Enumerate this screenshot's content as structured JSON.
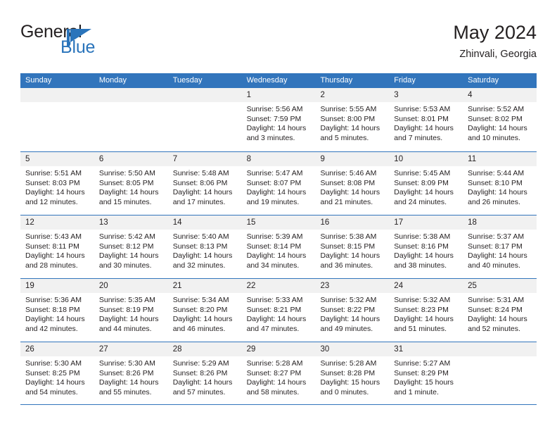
{
  "brand": {
    "name_part1": "General",
    "name_part2": "Blue",
    "logo_icon": "triangle-logo-icon"
  },
  "header": {
    "title": "May 2024",
    "subtitle": "Zhinvali, Georgia"
  },
  "colors": {
    "header_blue": "#3275bc",
    "brand_blue": "#2a74bb",
    "day_band_gray": "#f1f1f1",
    "text": "#231f20"
  },
  "weekdays": [
    "Sunday",
    "Monday",
    "Tuesday",
    "Wednesday",
    "Thursday",
    "Friday",
    "Saturday"
  ],
  "weeks": [
    [
      {
        "day": "",
        "empty": true,
        "sunrise": "",
        "sunset": "",
        "daylight_a": "",
        "daylight_b": ""
      },
      {
        "day": "",
        "empty": true,
        "sunrise": "",
        "sunset": "",
        "daylight_a": "",
        "daylight_b": ""
      },
      {
        "day": "",
        "empty": true,
        "sunrise": "",
        "sunset": "",
        "daylight_a": "",
        "daylight_b": ""
      },
      {
        "day": "1",
        "empty": false,
        "sunrise": "Sunrise: 5:56 AM",
        "sunset": "Sunset: 7:59 PM",
        "daylight_a": "Daylight: 14 hours",
        "daylight_b": "and 3 minutes."
      },
      {
        "day": "2",
        "empty": false,
        "sunrise": "Sunrise: 5:55 AM",
        "sunset": "Sunset: 8:00 PM",
        "daylight_a": "Daylight: 14 hours",
        "daylight_b": "and 5 minutes."
      },
      {
        "day": "3",
        "empty": false,
        "sunrise": "Sunrise: 5:53 AM",
        "sunset": "Sunset: 8:01 PM",
        "daylight_a": "Daylight: 14 hours",
        "daylight_b": "and 7 minutes."
      },
      {
        "day": "4",
        "empty": false,
        "sunrise": "Sunrise: 5:52 AM",
        "sunset": "Sunset: 8:02 PM",
        "daylight_a": "Daylight: 14 hours",
        "daylight_b": "and 10 minutes."
      }
    ],
    [
      {
        "day": "5",
        "empty": false,
        "sunrise": "Sunrise: 5:51 AM",
        "sunset": "Sunset: 8:03 PM",
        "daylight_a": "Daylight: 14 hours",
        "daylight_b": "and 12 minutes."
      },
      {
        "day": "6",
        "empty": false,
        "sunrise": "Sunrise: 5:50 AM",
        "sunset": "Sunset: 8:05 PM",
        "daylight_a": "Daylight: 14 hours",
        "daylight_b": "and 15 minutes."
      },
      {
        "day": "7",
        "empty": false,
        "sunrise": "Sunrise: 5:48 AM",
        "sunset": "Sunset: 8:06 PM",
        "daylight_a": "Daylight: 14 hours",
        "daylight_b": "and 17 minutes."
      },
      {
        "day": "8",
        "empty": false,
        "sunrise": "Sunrise: 5:47 AM",
        "sunset": "Sunset: 8:07 PM",
        "daylight_a": "Daylight: 14 hours",
        "daylight_b": "and 19 minutes."
      },
      {
        "day": "9",
        "empty": false,
        "sunrise": "Sunrise: 5:46 AM",
        "sunset": "Sunset: 8:08 PM",
        "daylight_a": "Daylight: 14 hours",
        "daylight_b": "and 21 minutes."
      },
      {
        "day": "10",
        "empty": false,
        "sunrise": "Sunrise: 5:45 AM",
        "sunset": "Sunset: 8:09 PM",
        "daylight_a": "Daylight: 14 hours",
        "daylight_b": "and 24 minutes."
      },
      {
        "day": "11",
        "empty": false,
        "sunrise": "Sunrise: 5:44 AM",
        "sunset": "Sunset: 8:10 PM",
        "daylight_a": "Daylight: 14 hours",
        "daylight_b": "and 26 minutes."
      }
    ],
    [
      {
        "day": "12",
        "empty": false,
        "sunrise": "Sunrise: 5:43 AM",
        "sunset": "Sunset: 8:11 PM",
        "daylight_a": "Daylight: 14 hours",
        "daylight_b": "and 28 minutes."
      },
      {
        "day": "13",
        "empty": false,
        "sunrise": "Sunrise: 5:42 AM",
        "sunset": "Sunset: 8:12 PM",
        "daylight_a": "Daylight: 14 hours",
        "daylight_b": "and 30 minutes."
      },
      {
        "day": "14",
        "empty": false,
        "sunrise": "Sunrise: 5:40 AM",
        "sunset": "Sunset: 8:13 PM",
        "daylight_a": "Daylight: 14 hours",
        "daylight_b": "and 32 minutes."
      },
      {
        "day": "15",
        "empty": false,
        "sunrise": "Sunrise: 5:39 AM",
        "sunset": "Sunset: 8:14 PM",
        "daylight_a": "Daylight: 14 hours",
        "daylight_b": "and 34 minutes."
      },
      {
        "day": "16",
        "empty": false,
        "sunrise": "Sunrise: 5:38 AM",
        "sunset": "Sunset: 8:15 PM",
        "daylight_a": "Daylight: 14 hours",
        "daylight_b": "and 36 minutes."
      },
      {
        "day": "17",
        "empty": false,
        "sunrise": "Sunrise: 5:38 AM",
        "sunset": "Sunset: 8:16 PM",
        "daylight_a": "Daylight: 14 hours",
        "daylight_b": "and 38 minutes."
      },
      {
        "day": "18",
        "empty": false,
        "sunrise": "Sunrise: 5:37 AM",
        "sunset": "Sunset: 8:17 PM",
        "daylight_a": "Daylight: 14 hours",
        "daylight_b": "and 40 minutes."
      }
    ],
    [
      {
        "day": "19",
        "empty": false,
        "sunrise": "Sunrise: 5:36 AM",
        "sunset": "Sunset: 8:18 PM",
        "daylight_a": "Daylight: 14 hours",
        "daylight_b": "and 42 minutes."
      },
      {
        "day": "20",
        "empty": false,
        "sunrise": "Sunrise: 5:35 AM",
        "sunset": "Sunset: 8:19 PM",
        "daylight_a": "Daylight: 14 hours",
        "daylight_b": "and 44 minutes."
      },
      {
        "day": "21",
        "empty": false,
        "sunrise": "Sunrise: 5:34 AM",
        "sunset": "Sunset: 8:20 PM",
        "daylight_a": "Daylight: 14 hours",
        "daylight_b": "and 46 minutes."
      },
      {
        "day": "22",
        "empty": false,
        "sunrise": "Sunrise: 5:33 AM",
        "sunset": "Sunset: 8:21 PM",
        "daylight_a": "Daylight: 14 hours",
        "daylight_b": "and 47 minutes."
      },
      {
        "day": "23",
        "empty": false,
        "sunrise": "Sunrise: 5:32 AM",
        "sunset": "Sunset: 8:22 PM",
        "daylight_a": "Daylight: 14 hours",
        "daylight_b": "and 49 minutes."
      },
      {
        "day": "24",
        "empty": false,
        "sunrise": "Sunrise: 5:32 AM",
        "sunset": "Sunset: 8:23 PM",
        "daylight_a": "Daylight: 14 hours",
        "daylight_b": "and 51 minutes."
      },
      {
        "day": "25",
        "empty": false,
        "sunrise": "Sunrise: 5:31 AM",
        "sunset": "Sunset: 8:24 PM",
        "daylight_a": "Daylight: 14 hours",
        "daylight_b": "and 52 minutes."
      }
    ],
    [
      {
        "day": "26",
        "empty": false,
        "sunrise": "Sunrise: 5:30 AM",
        "sunset": "Sunset: 8:25 PM",
        "daylight_a": "Daylight: 14 hours",
        "daylight_b": "and 54 minutes."
      },
      {
        "day": "27",
        "empty": false,
        "sunrise": "Sunrise: 5:30 AM",
        "sunset": "Sunset: 8:26 PM",
        "daylight_a": "Daylight: 14 hours",
        "daylight_b": "and 55 minutes."
      },
      {
        "day": "28",
        "empty": false,
        "sunrise": "Sunrise: 5:29 AM",
        "sunset": "Sunset: 8:26 PM",
        "daylight_a": "Daylight: 14 hours",
        "daylight_b": "and 57 minutes."
      },
      {
        "day": "29",
        "empty": false,
        "sunrise": "Sunrise: 5:28 AM",
        "sunset": "Sunset: 8:27 PM",
        "daylight_a": "Daylight: 14 hours",
        "daylight_b": "and 58 minutes."
      },
      {
        "day": "30",
        "empty": false,
        "sunrise": "Sunrise: 5:28 AM",
        "sunset": "Sunset: 8:28 PM",
        "daylight_a": "Daylight: 15 hours",
        "daylight_b": "and 0 minutes."
      },
      {
        "day": "31",
        "empty": false,
        "sunrise": "Sunrise: 5:27 AM",
        "sunset": "Sunset: 8:29 PM",
        "daylight_a": "Daylight: 15 hours",
        "daylight_b": "and 1 minute."
      },
      {
        "day": "",
        "empty": true,
        "sunrise": "",
        "sunset": "",
        "daylight_a": "",
        "daylight_b": ""
      }
    ]
  ]
}
